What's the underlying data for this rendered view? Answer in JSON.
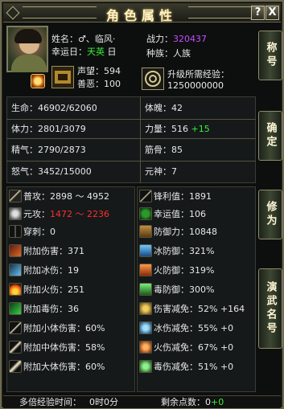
{
  "window": {
    "title": "角色属性",
    "help_label": "?",
    "close_label": "X"
  },
  "header": {
    "name_label": "姓名：",
    "name_value": "♂、临风·",
    "fortune_label": "幸运日：",
    "fortune_value": "天英",
    "fortune_day": "日",
    "power_label": "战力：",
    "power_value": "320437",
    "reputation_label": "声望：",
    "reputation_value": "594",
    "karma_label": "善恶：",
    "karma_value": "100",
    "race_label": "种族：",
    "race_value": "人族",
    "upgrade_label": "升级所需经验：",
    "upgrade_value": "1250000000"
  },
  "stats_left": [
    {
      "label": "生命：",
      "value": "46902/62060"
    },
    {
      "label": "体力：",
      "value": "2801/3079"
    },
    {
      "label": "精气：",
      "value": "2790/2873"
    },
    {
      "label": "怒气：",
      "value": "3452/15000"
    }
  ],
  "stats_right": [
    {
      "label": "体魄：",
      "value": "42",
      "bonus": ""
    },
    {
      "label": "力量：",
      "value": "516",
      "bonus": "+15"
    },
    {
      "label": "筋骨：",
      "value": "85",
      "bonus": ""
    },
    {
      "label": "元神：",
      "value": "7",
      "bonus": ""
    }
  ],
  "attack": [
    {
      "icon": "sword-icon",
      "label": "普攻：",
      "value": "2898 ～ 4952"
    },
    {
      "icon": "orb-icon",
      "label": "元攻：",
      "value": "1472 ～ 2236"
    },
    {
      "icon": "pierce-icon",
      "label": "穿刺：",
      "value": "0"
    },
    {
      "icon": "fire-dmg-icon",
      "label": "附加伤害：",
      "value": "371"
    },
    {
      "icon": "ice-dmg-icon",
      "label": "附加冰伤：",
      "value": "19"
    },
    {
      "icon": "flame-dmg-icon",
      "label": "附加火伤：",
      "value": "251"
    },
    {
      "icon": "poison-dmg-icon",
      "label": "附加毒伤：",
      "value": "36"
    },
    {
      "icon": "small-dmg-icon",
      "label": "附加小体伤害：",
      "value": "60%"
    },
    {
      "icon": "medium-dmg-icon",
      "label": "附加中体伤害：",
      "value": "58%"
    },
    {
      "icon": "large-dmg-icon",
      "label": "附加大体伤害：",
      "value": "60%"
    }
  ],
  "defense": [
    {
      "icon": "sharpness-icon",
      "label": "锋利值：",
      "value": "1891",
      "bonus": ""
    },
    {
      "icon": "clover-icon",
      "label": "幸运值：",
      "value": "106",
      "bonus": ""
    },
    {
      "icon": "shield-icon",
      "label": "防御力：",
      "value": "10848",
      "bonus": ""
    },
    {
      "icon": "ice-def-icon",
      "label": "冰防御：",
      "value": "321%",
      "bonus": ""
    },
    {
      "icon": "fire-def-icon",
      "label": "火防御：",
      "value": "319%",
      "bonus": ""
    },
    {
      "icon": "poison-def-icon",
      "label": "毒防御：",
      "value": "300%",
      "bonus": ""
    },
    {
      "icon": "dmg-reduce-icon",
      "label": "伤害减免：",
      "value": "52% +164",
      "bonus": ""
    },
    {
      "icon": "ice-reduce-icon",
      "label": "冰伤减免：",
      "value": "55% +0",
      "bonus": ""
    },
    {
      "icon": "fire-reduce-icon",
      "label": "火伤减免：",
      "value": "67% +0",
      "bonus": ""
    },
    {
      "icon": "poison-reduce-icon",
      "label": "毒伤减免：",
      "value": "51% +0",
      "bonus": ""
    }
  ],
  "side_buttons": [
    "称号",
    "确定",
    "修为",
    "演武名号"
  ],
  "footer": {
    "exp_label": "多倍经验时间：",
    "exp_value": "0时0分",
    "points_label": "剩余点数：",
    "points_value": "0",
    "points_bonus": "+0"
  },
  "colors": {
    "power": "#c64cff",
    "red": "#ff2e2e",
    "green": "#38f038",
    "frame": "#6d6a52"
  }
}
